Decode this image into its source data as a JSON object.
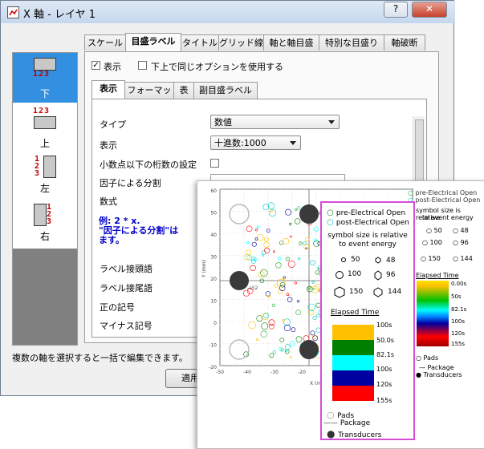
{
  "dialog": {
    "title": "X 軸 - レイヤ 1",
    "help_button": "?",
    "close_button": "✕",
    "minimize_button": "—",
    "footer_text": "複数の軸を選択すると一括で編集できます。",
    "apply_button": "適用"
  },
  "sidebar": {
    "items": [
      {
        "label": "下",
        "numbers": "123"
      },
      {
        "label": "上",
        "numbers": "123"
      },
      {
        "label": "左",
        "numbers": "1\n2\n3"
      },
      {
        "label": "右",
        "numbers": "1\n2\n3"
      }
    ]
  },
  "tabs": [
    "スケール",
    "目盛ラベル",
    "タイトル",
    "グリッド線",
    "軸と軸目盛",
    "特別な目盛り",
    "軸破断"
  ],
  "options": {
    "show_label": "表示",
    "same_options_label": "下上で同じオプションを使用する"
  },
  "subtabs": [
    "表示",
    "フォーマット",
    "表",
    "副目盛ラベル"
  ],
  "form": {
    "type_label": "タイプ",
    "type_value": "数値",
    "display_label": "表示",
    "display_value": "十進数:1000",
    "decimal_label": "小数点以下の桁数の設定",
    "divide_label": "因子による分割",
    "formula_label": "数式",
    "formula_example_1": "例: 2 * x.",
    "formula_example_2": "\"因子による分割\"は",
    "formula_example_3": "ます。",
    "prefix_label": "ラベル接頭語",
    "suffix_label": "ラベル接尾語",
    "plus_label": "正の記号",
    "minus_label": "マイナス記号"
  },
  "plot": {
    "ylabel": "Y (mm)",
    "xlabel": "X (mm)",
    "yticks": [
      "60",
      "50",
      "40",
      "30",
      "20",
      "10",
      "0",
      "-10",
      "-20"
    ],
    "xticks": [
      "-50",
      "-40",
      "-30",
      "-20",
      "-10",
      "0",
      "10",
      "20"
    ],
    "annot": "-a52"
  },
  "legend": {
    "pre": "pre-Electrical Open",
    "post": "post-Electrical Open",
    "size_note_1": "symbol size is relative",
    "size_note_2": "to event energy",
    "sizes": [
      "50",
      "48",
      "100",
      "96",
      "150",
      "144"
    ],
    "elapsed_title": "Elapsed Time",
    "times": [
      "100s",
      "50.0s",
      "82.1s",
      "100s",
      "120s",
      "155s"
    ],
    "pads": "Pads",
    "package": "Package",
    "transducers": "Transducers",
    "colors": [
      "#ffc000",
      "#008000",
      "#00ffff",
      "#0000a0",
      "#ff0000"
    ]
  },
  "bg_legend": {
    "pre": "pre-Electrical Open",
    "post": "post-Electrical Open",
    "note_1": "symbol size is relative",
    "note_2": "to event energy",
    "sizes": [
      "50",
      "48",
      "100",
      "96",
      "150",
      "144"
    ],
    "elapsed_title": "Elapsed Time",
    "ramp_labels": [
      "0.00s",
      "50s",
      "82.1s",
      "100s",
      "120s",
      "155s"
    ],
    "pads": "Pads",
    "package": "Package",
    "transducers": "Transducers"
  }
}
